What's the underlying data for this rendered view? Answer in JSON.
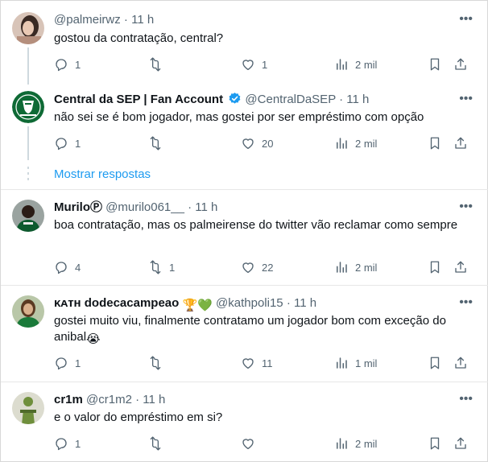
{
  "posts": [
    {
      "name": "",
      "handle": "@palmeirwz",
      "time": "11 h",
      "text": "gostou da contratação, central?",
      "replies": "1",
      "reposts": "",
      "likes": "1",
      "views": "2 mil",
      "avatar_color": "#c9b2a6"
    },
    {
      "name": "Central da SEP | Fan Account",
      "handle": "@CentralDaSEP",
      "time": "11 h",
      "text": "não sei se é bom jogador, mas gostei por ser empréstimo com opção",
      "replies": "1",
      "reposts": "",
      "likes": "20",
      "views": "2 mil",
      "avatar_color": "#1a7a3a"
    },
    {
      "name": "MuriloⓅ",
      "handle": "@murilo061__",
      "time": "11 h",
      "text": "boa contratação, mas os palmeirense do twitter vão reclamar como sempre",
      "replies": "4",
      "reposts": "1",
      "likes": "22",
      "views": "2 mil",
      "avatar_color": "#2b2b2b"
    },
    {
      "name": "ᴋᴀᴛʜ dodecacampeao",
      "handle": "@kathpoli15",
      "time": "11 h",
      "text": "gostei muito viu, finalmente contratamo um jogador bom com exceção do anibal",
      "replies": "1",
      "reposts": "",
      "likes": "11",
      "views": "1 mil",
      "avatar_color": "#6b8a4e"
    },
    {
      "name": "cr1m",
      "handle": "@cr1m2",
      "time": "11 h",
      "text": "e o valor do empréstimo em si?",
      "replies": "1",
      "reposts": "",
      "likes": "",
      "views": "2 mil",
      "avatar_color": "#8fa36c"
    }
  ],
  "separator": "·",
  "show_replies_label": "Mostrar respostas",
  "emoji": {
    "trophy": "🏆",
    "green_heart": "💚",
    "crying": "😭"
  },
  "colors": {
    "text": "#0f1419",
    "secondary": "#536471",
    "link": "#1d9bf0",
    "verified": "#1d9bf0"
  }
}
